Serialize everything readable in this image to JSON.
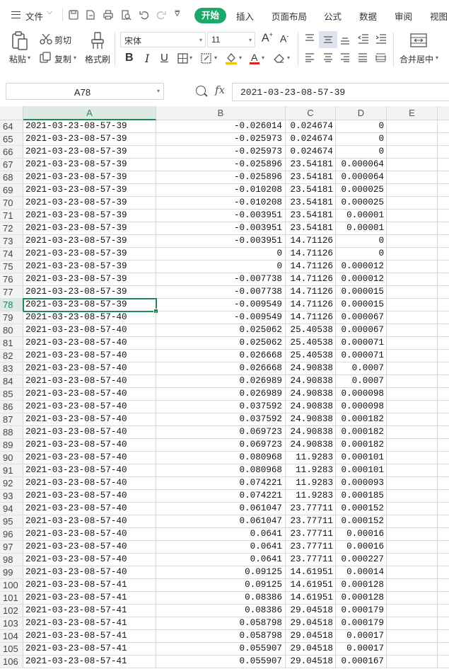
{
  "menu": {
    "file_label": "文件",
    "tabs": [
      "开始",
      "插入",
      "页面布局",
      "公式",
      "数据",
      "审阅",
      "视图"
    ],
    "active_tab": "开始"
  },
  "ribbon": {
    "paste_label": "粘贴",
    "cut_label": "剪切",
    "copy_label": "复制",
    "format_painter_label": "格式刷",
    "font_name": "宋体",
    "font_size": "11",
    "merge_label": "合并居中"
  },
  "formula_bar": {
    "cell_ref": "A78",
    "fx_label": "fx",
    "content": "2021-03-23-08-57-39"
  },
  "columns": [
    "A",
    "B",
    "C",
    "D",
    "E"
  ],
  "active_column": "A",
  "active_row": "78",
  "rows": [
    {
      "n": "64",
      "a": "2021-03-23-08-57-39",
      "b": "-0.026014",
      "c": "0.024674",
      "d": "0"
    },
    {
      "n": "65",
      "a": "2021-03-23-08-57-39",
      "b": "-0.025973",
      "c": "0.024674",
      "d": "0"
    },
    {
      "n": "66",
      "a": "2021-03-23-08-57-39",
      "b": "-0.025973",
      "c": "0.024674",
      "d": "0"
    },
    {
      "n": "67",
      "a": "2021-03-23-08-57-39",
      "b": "-0.025896",
      "c": "23.54181",
      "d": "0.000064"
    },
    {
      "n": "68",
      "a": "2021-03-23-08-57-39",
      "b": "-0.025896",
      "c": "23.54181",
      "d": "0.000064"
    },
    {
      "n": "69",
      "a": "2021-03-23-08-57-39",
      "b": "-0.010208",
      "c": "23.54181",
      "d": "0.000025"
    },
    {
      "n": "70",
      "a": "2021-03-23-08-57-39",
      "b": "-0.010208",
      "c": "23.54181",
      "d": "0.000025"
    },
    {
      "n": "71",
      "a": "2021-03-23-08-57-39",
      "b": "-0.003951",
      "c": "23.54181",
      "d": "0.00001"
    },
    {
      "n": "72",
      "a": "2021-03-23-08-57-39",
      "b": "-0.003951",
      "c": "23.54181",
      "d": "0.00001"
    },
    {
      "n": "73",
      "a": "2021-03-23-08-57-39",
      "b": "-0.003951",
      "c": "14.71126",
      "d": "0"
    },
    {
      "n": "74",
      "a": "2021-03-23-08-57-39",
      "b": "0",
      "c": "14.71126",
      "d": "0"
    },
    {
      "n": "75",
      "a": "2021-03-23-08-57-39",
      "b": "0",
      "c": "14.71126",
      "d": "0.000012"
    },
    {
      "n": "76",
      "a": "2021-03-23-08-57-39",
      "b": "-0.007738",
      "c": "14.71126",
      "d": "0.000012"
    },
    {
      "n": "77",
      "a": "2021-03-23-08-57-39",
      "b": "-0.007738",
      "c": "14.71126",
      "d": "0.000015"
    },
    {
      "n": "78",
      "a": "2021-03-23-08-57-39",
      "b": "-0.009549",
      "c": "14.71126",
      "d": "0.000015"
    },
    {
      "n": "79",
      "a": "2021-03-23-08-57-40",
      "b": "-0.009549",
      "c": "14.71126",
      "d": "0.000067"
    },
    {
      "n": "80",
      "a": "2021-03-23-08-57-40",
      "b": "0.025062",
      "c": "25.40538",
      "d": "0.000067"
    },
    {
      "n": "81",
      "a": "2021-03-23-08-57-40",
      "b": "0.025062",
      "c": "25.40538",
      "d": "0.000071"
    },
    {
      "n": "82",
      "a": "2021-03-23-08-57-40",
      "b": "0.026668",
      "c": "25.40538",
      "d": "0.000071"
    },
    {
      "n": "83",
      "a": "2021-03-23-08-57-40",
      "b": "0.026668",
      "c": "24.90838",
      "d": "0.0007"
    },
    {
      "n": "84",
      "a": "2021-03-23-08-57-40",
      "b": "0.026989",
      "c": "24.90838",
      "d": "0.0007"
    },
    {
      "n": "85",
      "a": "2021-03-23-08-57-40",
      "b": "0.026989",
      "c": "24.90838",
      "d": "0.000098"
    },
    {
      "n": "86",
      "a": "2021-03-23-08-57-40",
      "b": "0.037592",
      "c": "24.90838",
      "d": "0.000098"
    },
    {
      "n": "87",
      "a": "2021-03-23-08-57-40",
      "b": "0.037592",
      "c": "24.90838",
      "d": "0.000182"
    },
    {
      "n": "88",
      "a": "2021-03-23-08-57-40",
      "b": "0.069723",
      "c": "24.90838",
      "d": "0.000182"
    },
    {
      "n": "89",
      "a": "2021-03-23-08-57-40",
      "b": "0.069723",
      "c": "24.90838",
      "d": "0.000182"
    },
    {
      "n": "90",
      "a": "2021-03-23-08-57-40",
      "b": "0.080968",
      "c": "11.9283",
      "d": "0.000101"
    },
    {
      "n": "91",
      "a": "2021-03-23-08-57-40",
      "b": "0.080968",
      "c": "11.9283",
      "d": "0.000101"
    },
    {
      "n": "92",
      "a": "2021-03-23-08-57-40",
      "b": "0.074221",
      "c": "11.9283",
      "d": "0.000093"
    },
    {
      "n": "93",
      "a": "2021-03-23-08-57-40",
      "b": "0.074221",
      "c": "11.9283",
      "d": "0.000185"
    },
    {
      "n": "94",
      "a": "2021-03-23-08-57-40",
      "b": "0.061047",
      "c": "23.77711",
      "d": "0.000152"
    },
    {
      "n": "95",
      "a": "2021-03-23-08-57-40",
      "b": "0.061047",
      "c": "23.77711",
      "d": "0.000152"
    },
    {
      "n": "96",
      "a": "2021-03-23-08-57-40",
      "b": "0.0641",
      "c": "23.77711",
      "d": "0.00016"
    },
    {
      "n": "97",
      "a": "2021-03-23-08-57-40",
      "b": "0.0641",
      "c": "23.77711",
      "d": "0.00016"
    },
    {
      "n": "98",
      "a": "2021-03-23-08-57-40",
      "b": "0.0641",
      "c": "23.77711",
      "d": "0.000227"
    },
    {
      "n": "99",
      "a": "2021-03-23-08-57-40",
      "b": "0.09125",
      "c": "14.61951",
      "d": "0.00014"
    },
    {
      "n": "100",
      "a": "2021-03-23-08-57-41",
      "b": "0.09125",
      "c": "14.61951",
      "d": "0.000128"
    },
    {
      "n": "101",
      "a": "2021-03-23-08-57-41",
      "b": "0.08386",
      "c": "14.61951",
      "d": "0.000128"
    },
    {
      "n": "102",
      "a": "2021-03-23-08-57-41",
      "b": "0.08386",
      "c": "29.04518",
      "d": "0.000179"
    },
    {
      "n": "103",
      "a": "2021-03-23-08-57-41",
      "b": "0.058798",
      "c": "29.04518",
      "d": "0.000179"
    },
    {
      "n": "104",
      "a": "2021-03-23-08-57-41",
      "b": "0.058798",
      "c": "29.04518",
      "d": "0.00017"
    },
    {
      "n": "105",
      "a": "2021-03-23-08-57-41",
      "b": "0.055907",
      "c": "29.04518",
      "d": "0.00017"
    },
    {
      "n": "106",
      "a": "2021-03-23-08-57-41",
      "b": "0.055907",
      "c": "29.04518",
      "d": "0.000167"
    }
  ],
  "colors": {
    "accent": "#1aa96b",
    "selection": "#1c8a57"
  }
}
